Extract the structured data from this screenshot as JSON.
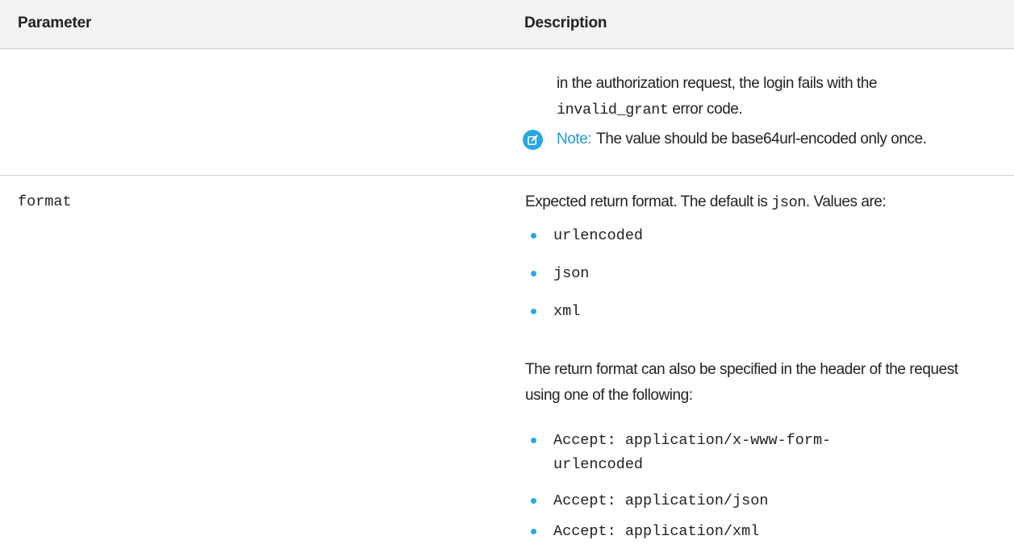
{
  "table": {
    "headers": {
      "parameter": "Parameter",
      "description": "Description"
    },
    "continued_row": {
      "text_before": "in the authorization request, the login fails with the",
      "code": "invalid_grant",
      "text_after": "error code.",
      "note_label": "Note:",
      "note_text": "The value should be base64url-encoded only once."
    },
    "format_row": {
      "param": "format",
      "intro_before": "Expected return format. The default is",
      "intro_code": "json",
      "intro_after": ". Values are:",
      "values": [
        "urlencoded",
        "json",
        "xml"
      ],
      "after_text": "The return format can also be specified in the header of the request using one of the following:",
      "headers": [
        "Accept: application/x-www-form-urlencoded",
        "Accept: application/json",
        "Accept: application/xml"
      ]
    }
  },
  "colors": {
    "accent": "#2aa7e1",
    "note_label": "#1e9ad6",
    "header_bg": "#f3f3f3"
  },
  "icons": {
    "note": "note-edit-icon",
    "bullet": "bullet-dot-icon"
  }
}
